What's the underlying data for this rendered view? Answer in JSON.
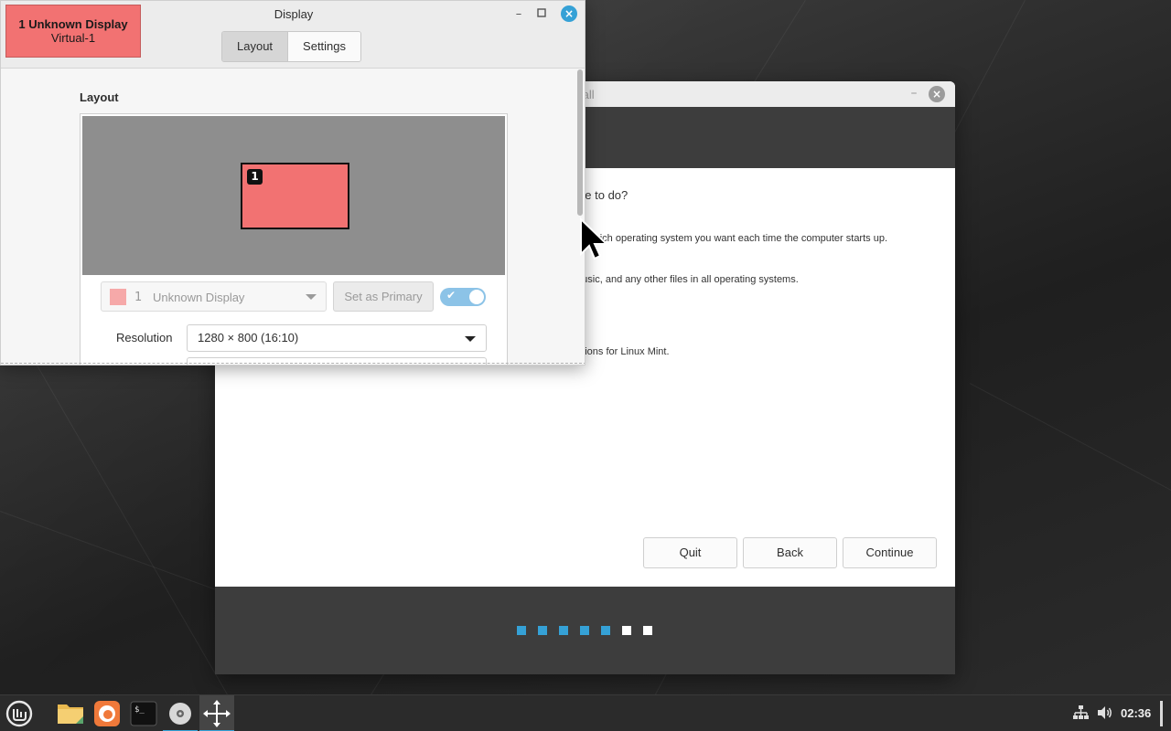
{
  "installer": {
    "title": "tall",
    "question": "like to do?",
    "lines": [
      "se which operating system you want each time the computer starts up.",
      "music, and any other files in all operating systems.",
      "rtitions for Linux Mint."
    ],
    "buttons": {
      "quit": "Quit",
      "back": "Back",
      "continue": "Continue"
    },
    "progress": {
      "completed_steps": 5,
      "total_steps": 7
    },
    "colors": {
      "step_done": "#35a1d6",
      "step_todo": "#ffffff"
    }
  },
  "display_window": {
    "title": "Display",
    "overlay": {
      "line1": "1  Unknown Display",
      "line2": "Virtual-1"
    },
    "tabs": [
      {
        "label": "Layout",
        "active": true
      },
      {
        "label": "Settings",
        "active": false
      }
    ],
    "section_label": "Layout",
    "monitor_number": "1",
    "monitor_selector": {
      "number": "1",
      "name": "Unknown Display"
    },
    "set_primary_label": "Set as Primary",
    "enabled": true,
    "resolution_label": "Resolution",
    "resolution_value": "1280 × 800 (16:10)",
    "colors": {
      "monitor": "#f27272",
      "accent": "#35a1d6"
    }
  },
  "taskbar": {
    "apps": [
      "mint-menu-icon",
      "files-icon",
      "firefox-icon",
      "terminal-icon",
      "disc-icon",
      "move-icon"
    ],
    "clock": "02:36"
  }
}
